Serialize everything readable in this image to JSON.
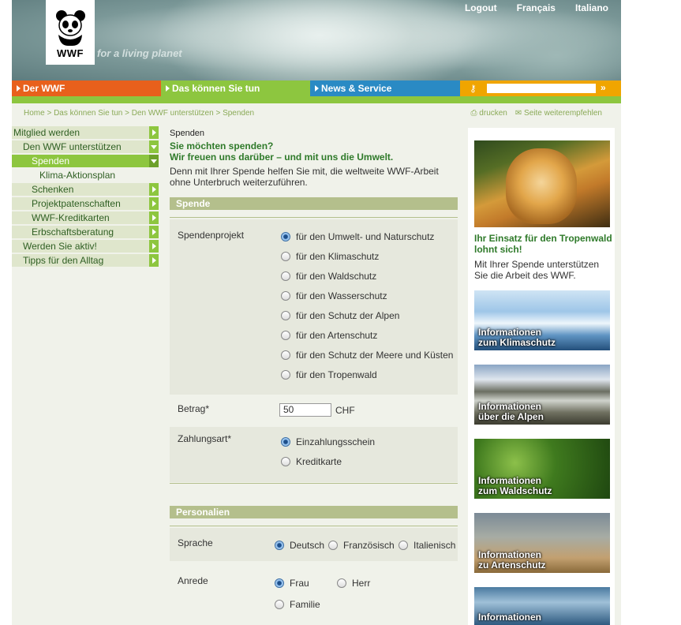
{
  "header": {
    "tagline": "for a living planet",
    "logo_text": "WWF",
    "links": [
      "Logout",
      "Français",
      "Italiano"
    ]
  },
  "nav": {
    "tabs": [
      "Der WWF",
      "Das können Sie tun",
      "News & Service"
    ],
    "search_placeholder": "",
    "search_go": "»"
  },
  "breadcrumb": "Home > Das können Sie tun > Den WWF unterstützen > Spenden",
  "tools": {
    "print": "drucken",
    "recommend": "Seite weiterempfehlen"
  },
  "sidemenu": [
    {
      "label": "Mitglied werden",
      "level": 0
    },
    {
      "label": "Den WWF unterstützen",
      "level": 0
    },
    {
      "label": "Spenden",
      "level": 1,
      "active": true
    },
    {
      "label": "Klima-Aktionsplan",
      "level": 2
    },
    {
      "label": "Schenken",
      "level": 1
    },
    {
      "label": "Projektpatenschaften",
      "level": 1
    },
    {
      "label": "WWF-Kreditkarten",
      "level": 1
    },
    {
      "label": "Erbschaftsberatung",
      "level": 1
    },
    {
      "label": "Werden Sie aktiv!",
      "level": 0
    },
    {
      "label": "Tipps für den Alltag",
      "level": 0
    }
  ],
  "main": {
    "page_label": "Spenden",
    "heading_line1": "Sie möchten spenden?",
    "heading_line2": "Wir freuen uns darüber – und mit uns die Umwelt.",
    "intro_line1": "Denn mit Ihrer Spende helfen Sie mit, die weltweite WWF-Arbeit",
    "intro_line2": "ohne Unterbruch weiterzuführen.",
    "section_spende": "Spende",
    "project_label": "Spendenprojekt",
    "projects": [
      {
        "label": "für den Umwelt- und Naturschutz",
        "checked": true
      },
      {
        "label": "für den Klimaschutz",
        "checked": false
      },
      {
        "label": "für den Waldschutz",
        "checked": false
      },
      {
        "label": "für den Wasserschutz",
        "checked": false
      },
      {
        "label": "für den Schutz der Alpen",
        "checked": false
      },
      {
        "label": "für den Artenschutz",
        "checked": false
      },
      {
        "label": "für den Schutz der Meere und Küsten",
        "checked": false
      },
      {
        "label": "für den Tropenwald",
        "checked": false
      }
    ],
    "amount_label": "Betrag*",
    "amount_value": "50",
    "currency": "CHF",
    "payment_label": "Zahlungsart*",
    "payment_options": [
      {
        "label": "Einzahlungsschein",
        "checked": true
      },
      {
        "label": "Kreditkarte",
        "checked": false
      }
    ],
    "section_personal": "Personalien",
    "language_label": "Sprache",
    "languages": [
      {
        "label": "Deutsch",
        "checked": true
      },
      {
        "label": "Französisch",
        "checked": false
      },
      {
        "label": "Italienisch",
        "checked": false
      }
    ],
    "salutation_label": "Anrede",
    "salutations": [
      {
        "label": "Frau",
        "checked": true
      },
      {
        "label": "Herr",
        "checked": false
      },
      {
        "label": "Familie",
        "checked": false
      }
    ]
  },
  "right": {
    "promo_title_line1": "Ihr Einsatz für den Tropenwald",
    "promo_title_line2": "lohnt sich!",
    "promo_text_line1": "Mit Ihrer Spende unterstützen",
    "promo_text_line2": "Sie die Arbeit des WWF.",
    "tiles": [
      {
        "line1": "Informationen",
        "line2": "zum Klimaschutz"
      },
      {
        "line1": "Informationen",
        "line2": "über die Alpen"
      },
      {
        "line1": "Informationen",
        "line2": "zum Waldschutz"
      },
      {
        "line1": "Informationen",
        "line2": "zu Artenschutz"
      },
      {
        "line1": "Informationen",
        "line2": ""
      }
    ]
  }
}
